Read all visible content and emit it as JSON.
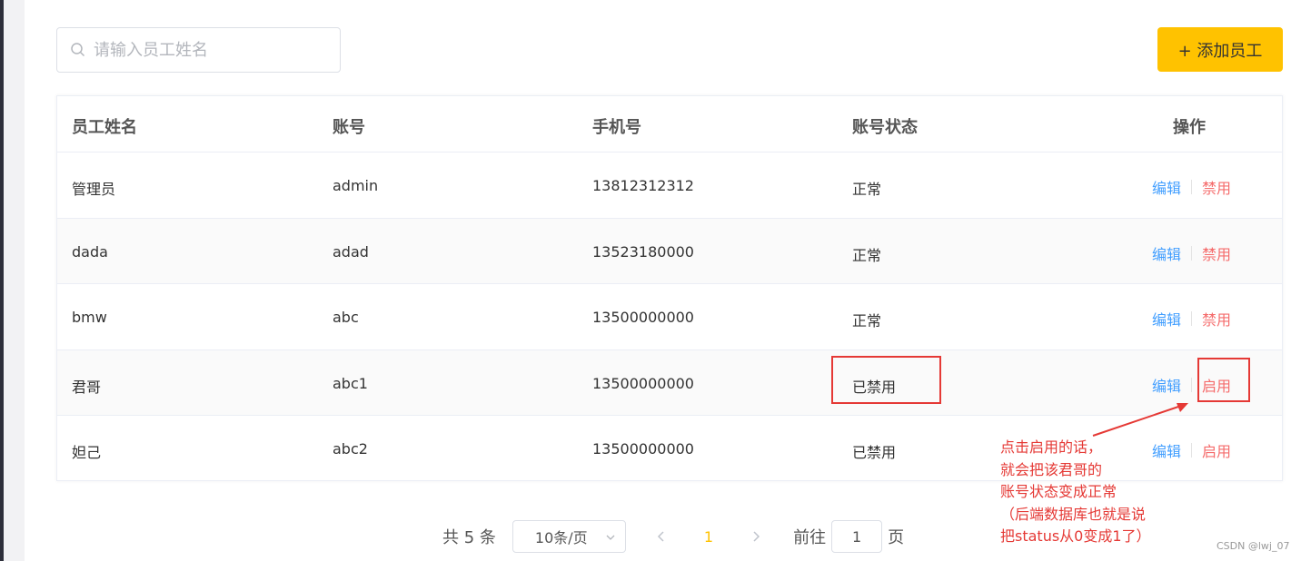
{
  "search": {
    "placeholder": "请输入员工姓名",
    "value": ""
  },
  "toolbar": {
    "add_label": "+ 添加员工"
  },
  "table": {
    "headers": {
      "name": "员工姓名",
      "account": "账号",
      "phone": "手机号",
      "status": "账号状态",
      "ops": "操作"
    },
    "rows": [
      {
        "name": "管理员",
        "account": "admin",
        "phone": "13812312312",
        "status": "正常",
        "edit": "编辑",
        "toggle": "禁用"
      },
      {
        "name": "dada",
        "account": "adad",
        "phone": "13523180000",
        "status": "正常",
        "edit": "编辑",
        "toggle": "禁用"
      },
      {
        "name": "bmw",
        "account": "abc",
        "phone": "13500000000",
        "status": "正常",
        "edit": "编辑",
        "toggle": "禁用"
      },
      {
        "name": "君哥",
        "account": "abc1",
        "phone": "13500000000",
        "status": "已禁用",
        "edit": "编辑",
        "toggle": "启用"
      },
      {
        "name": "妲己",
        "account": "abc2",
        "phone": "13500000000",
        "status": "已禁用",
        "edit": "编辑",
        "toggle": "启用"
      }
    ]
  },
  "pagination": {
    "total": "共 5 条",
    "page_size": "10条/页",
    "current_page": "1",
    "goto_label": "前往",
    "goto_value": "1",
    "page_suffix": "页"
  },
  "annotation": {
    "lines": [
      "点击启用的话，",
      "就会把该君哥的",
      "账号状态变成正常",
      "（后端数据库也就是说",
      "把status从0变成1了）"
    ]
  },
  "watermark": "CSDN @lwj_07",
  "colors": {
    "accent": "#ffc200",
    "edit": "#419eff",
    "danger": "#f56c6c",
    "annotation": "#e53935"
  }
}
